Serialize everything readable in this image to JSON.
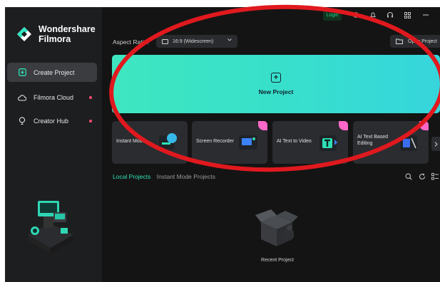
{
  "app": {
    "brand_line1": "Wondershare",
    "brand_line2": "Filmora"
  },
  "sidebar": {
    "items": [
      {
        "label": "Create Project",
        "active": true,
        "icon": "plus-square-icon"
      },
      {
        "label": "Filmora Cloud",
        "active": false,
        "icon": "cloud-icon",
        "dot": true
      },
      {
        "label": "Creator Hub",
        "active": false,
        "icon": "lightbulb-icon",
        "dot": true
      }
    ]
  },
  "topbar": {
    "login_label": "Login",
    "icons": [
      "gear-icon",
      "notification-icon",
      "headset-icon",
      "grid-icon",
      "minimize-icon"
    ]
  },
  "toolbar": {
    "aspect_label": "Aspect Ratio:",
    "aspect_value": "16:9 (Widescreen)",
    "open_project_label": "Open Project"
  },
  "new_project": {
    "label": "New Project"
  },
  "cards": [
    {
      "label": "Instant Mode",
      "badge": false
    },
    {
      "label": "Screen Recorder",
      "badge": true
    },
    {
      "label": "AI Text to Video",
      "badge": true
    },
    {
      "label": "AI Text Based Editing",
      "badge": true
    }
  ],
  "project_tabs": {
    "local": "Local Projects",
    "instant": "Instant Mode Projects"
  },
  "recent": {
    "label": "Recent Project"
  },
  "colors": {
    "accent": "#2ee0b5",
    "annotation": "#e0191e",
    "badge": "#ff67c8",
    "dot": "#ff4d6d"
  }
}
